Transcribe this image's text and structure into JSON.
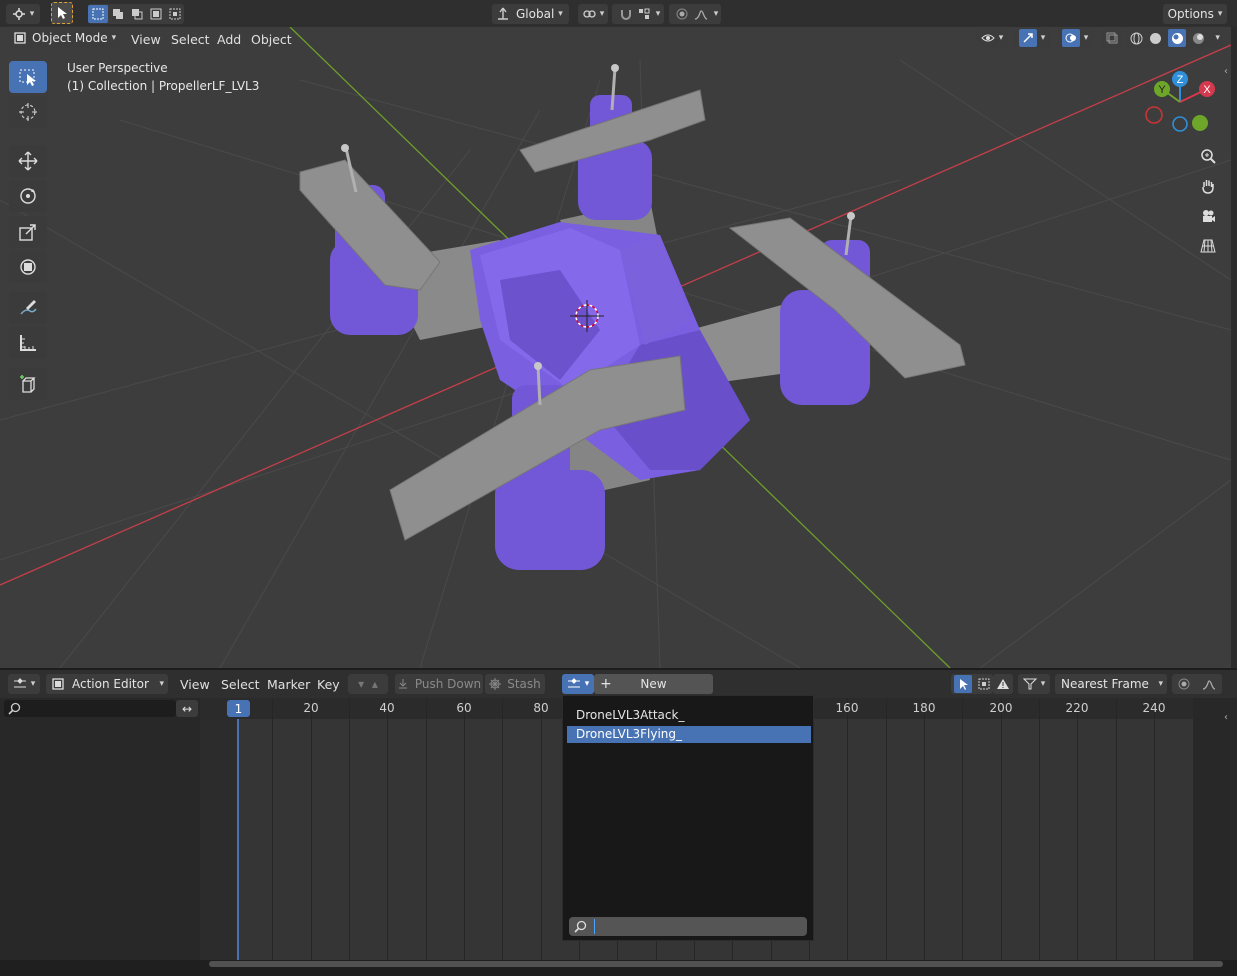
{
  "top_toolbar": {
    "orientation_label": "Global",
    "options_label": "Options"
  },
  "viewport_header": {
    "mode_label": "Object Mode",
    "menus": [
      "View",
      "Select",
      "Add",
      "Object"
    ]
  },
  "viewport": {
    "perspective_label": "User Perspective",
    "collection_label": "(1) Collection | PropellerLF_LVL3",
    "gizmo_axes": {
      "x": "X",
      "y": "Y",
      "z": "Z"
    }
  },
  "action_editor_header": {
    "editor_type_label": "Action Editor",
    "menus": [
      "View",
      "Select",
      "Marker",
      "Key"
    ],
    "push_down_label": "Push Down",
    "stash_label": "Stash",
    "new_label": "New",
    "snap_label": "Nearest Frame"
  },
  "timeline": {
    "current_frame": "1",
    "ticks": [
      "20",
      "40",
      "60",
      "80",
      "160",
      "180",
      "200",
      "220",
      "240"
    ]
  },
  "action_popup": {
    "items": [
      {
        "label": "DroneLVL3Attack_",
        "selected": false
      },
      {
        "label": "DroneLVL3Flying_",
        "selected": true
      }
    ],
    "search_placeholder": ""
  },
  "colors": {
    "accent": "#4772b3",
    "drone_body": "#7358d6",
    "propeller": "#8d8d8d",
    "axis_x": "#c43f4a",
    "axis_y": "#6e9e2a",
    "viewport_bg": "#3d3d3d"
  }
}
